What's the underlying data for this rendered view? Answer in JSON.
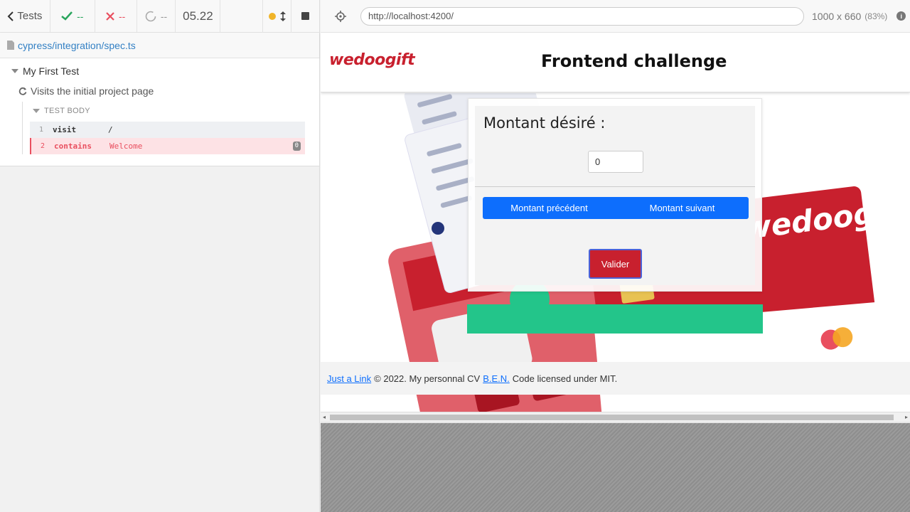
{
  "reporter": {
    "header": {
      "tests_label": "Tests",
      "passed_count": "--",
      "failed_count": "--",
      "pending_count": "--",
      "duration": "05.22"
    },
    "spec_path": "cypress/integration/spec.ts",
    "suite": {
      "title": "My First Test",
      "test_title": "Visits the initial project page",
      "body_label": "TEST BODY",
      "commands": [
        {
          "num": "1",
          "name": "visit",
          "message": "/",
          "state": "passed"
        },
        {
          "num": "2",
          "name": "contains",
          "message": "Welcome",
          "state": "failed",
          "badge": "0"
        }
      ]
    }
  },
  "aut": {
    "url": "http://localhost:4200/",
    "viewport": "1000 x 660",
    "scale": "(83%)"
  },
  "app": {
    "logo_text": "wedoogift",
    "title": "Frontend challenge",
    "amount_label": "Montant désiré :",
    "amount_value": "0",
    "prev_button": "Montant précédent",
    "next_button": "Montant suivant",
    "submit_button": "Valider",
    "bg_card_brand": "wedoogift",
    "footer": {
      "link1": "Just a Link",
      "text": "© 2022. My personnal CV",
      "link2": "B.E.N.",
      "text2": "Code licensed under MIT."
    }
  },
  "colors": {
    "brand_red": "#c8202e",
    "primary_blue": "#0d6efd",
    "success_green": "#23c58a",
    "pass": "#2aa55d",
    "fail": "#e94f5f"
  }
}
